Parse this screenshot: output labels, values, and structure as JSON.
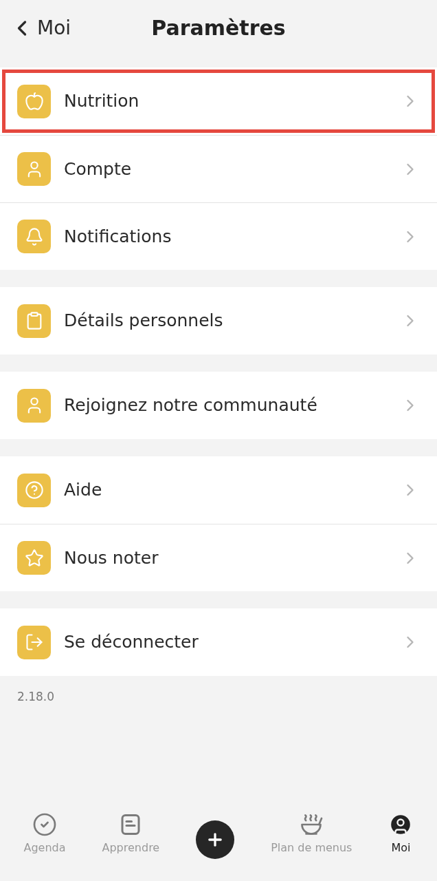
{
  "header": {
    "back_label": "Moi",
    "title": "Paramètres"
  },
  "groups": [
    {
      "items": [
        {
          "label": "Nutrition",
          "highlighted": true
        },
        {
          "label": "Compte",
          "highlighted": false
        },
        {
          "label": "Notifications",
          "highlighted": false
        }
      ]
    },
    {
      "items": [
        {
          "label": "Détails personnels",
          "highlighted": false
        }
      ]
    },
    {
      "items": [
        {
          "label": "Rejoignez notre communauté",
          "highlighted": false
        }
      ]
    },
    {
      "items": [
        {
          "label": "Aide",
          "highlighted": false
        },
        {
          "label": "Nous noter",
          "highlighted": false
        }
      ]
    },
    {
      "items": [
        {
          "label": "Se déconnecter",
          "highlighted": false
        }
      ]
    }
  ],
  "version": "2.18.0",
  "nav": [
    {
      "label": "Agenda",
      "selected": false
    },
    {
      "label": "Apprendre",
      "selected": false
    },
    {
      "kind": "add"
    },
    {
      "label": "Plan de menus",
      "selected": false
    },
    {
      "label": "Moi",
      "selected": true
    }
  ]
}
